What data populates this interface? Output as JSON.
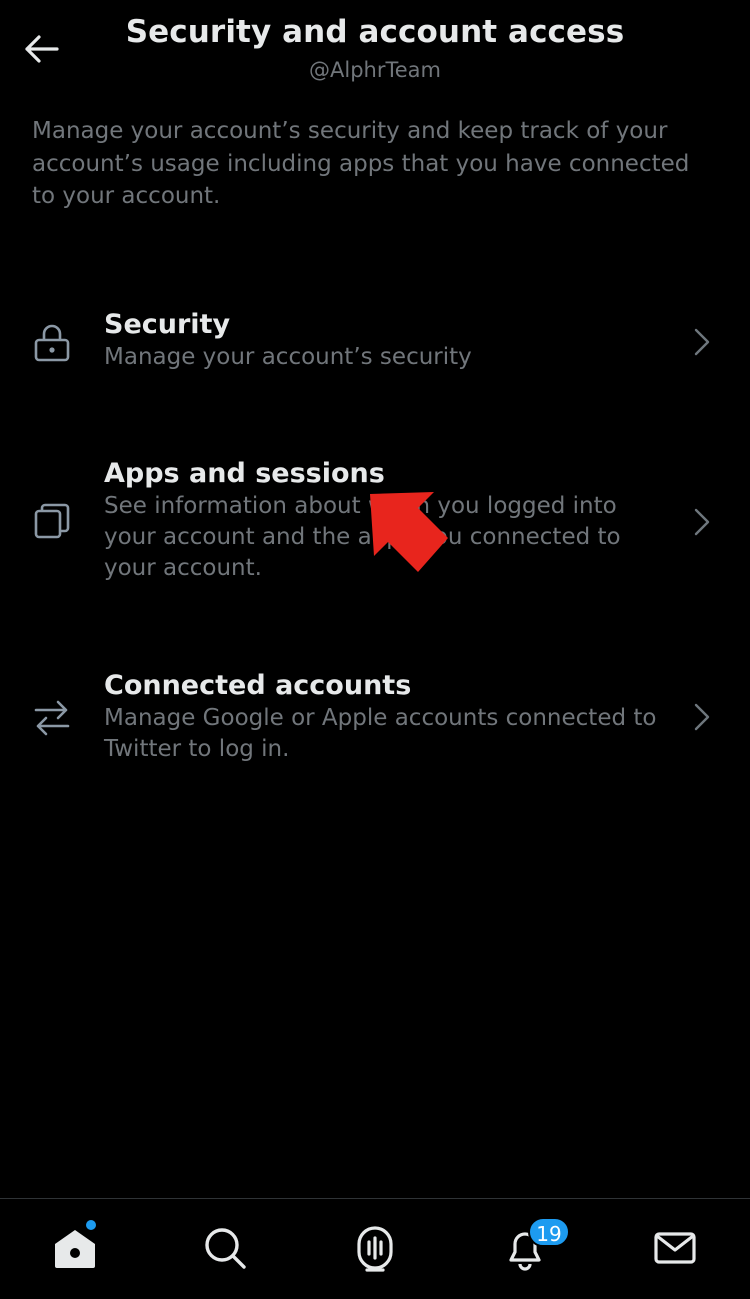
{
  "header": {
    "title": "Security and account access",
    "subtitle": "@AlphrTeam"
  },
  "intro": "Manage your account’s security and keep track of your account’s usage including apps that you have connected to your account.",
  "menu": [
    {
      "title": "Security",
      "description": "Manage your account’s security",
      "icon": "lock-icon"
    },
    {
      "title": "Apps and sessions",
      "description": "See information about when you logged into your account and the apps you connected to your account.",
      "icon": "copy-icon"
    },
    {
      "title": "Connected accounts",
      "description": "Manage Google or Apple accounts connected to Twitter to log in.",
      "icon": "swap-arrows-icon"
    }
  ],
  "bottom_nav": {
    "items": [
      "home-icon",
      "search-icon",
      "spaces-icon",
      "notifications-icon",
      "messages-icon"
    ],
    "notifications_badge": "19"
  },
  "colors": {
    "background": "#000000",
    "primary_text": "#e7e9ea",
    "secondary_text": "#71767b",
    "accent": "#1d9bf0",
    "annotation_arrow": "#e8251d"
  }
}
